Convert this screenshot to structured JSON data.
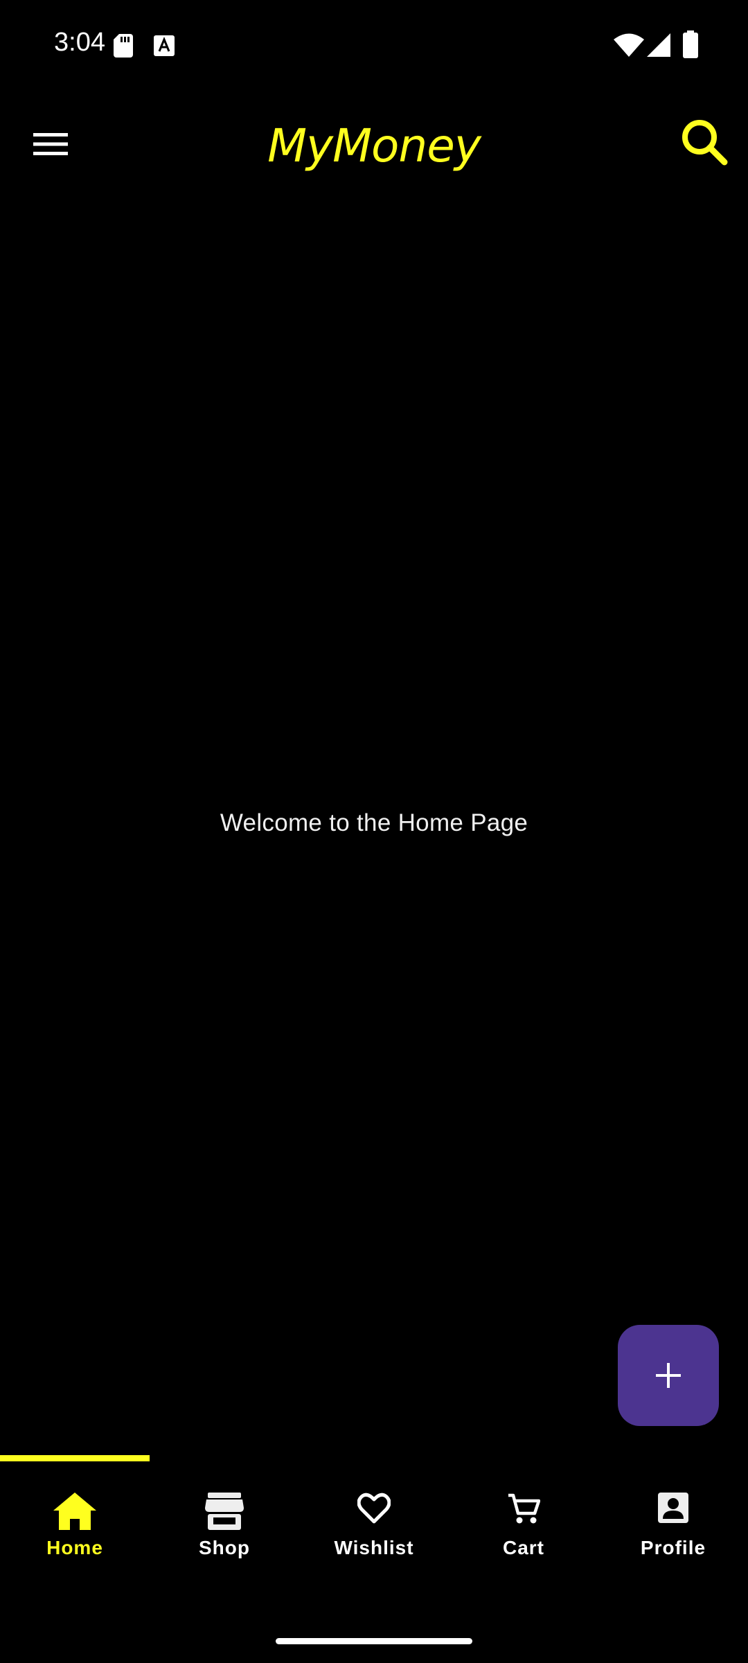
{
  "status_bar": {
    "time": "3:04",
    "icons": [
      "sd-card-icon",
      "a-notification-icon",
      "wifi-icon",
      "signal-icon",
      "battery-icon"
    ]
  },
  "app_bar": {
    "title": "MyMoney",
    "accent_color": "#FFFF1F",
    "left_icon": "menu-icon",
    "right_icon": "search-icon"
  },
  "main": {
    "welcome_text": "Welcome to the Home Page"
  },
  "fab": {
    "icon": "plus-icon",
    "color": "#4C3490"
  },
  "bottom_nav": {
    "active_index": 0,
    "items": [
      {
        "label": "Home",
        "icon": "home-icon"
      },
      {
        "label": "Shop",
        "icon": "store-icon"
      },
      {
        "label": "Wishlist",
        "icon": "heart-icon"
      },
      {
        "label": "Cart",
        "icon": "cart-icon"
      },
      {
        "label": "Profile",
        "icon": "profile-icon"
      }
    ]
  }
}
